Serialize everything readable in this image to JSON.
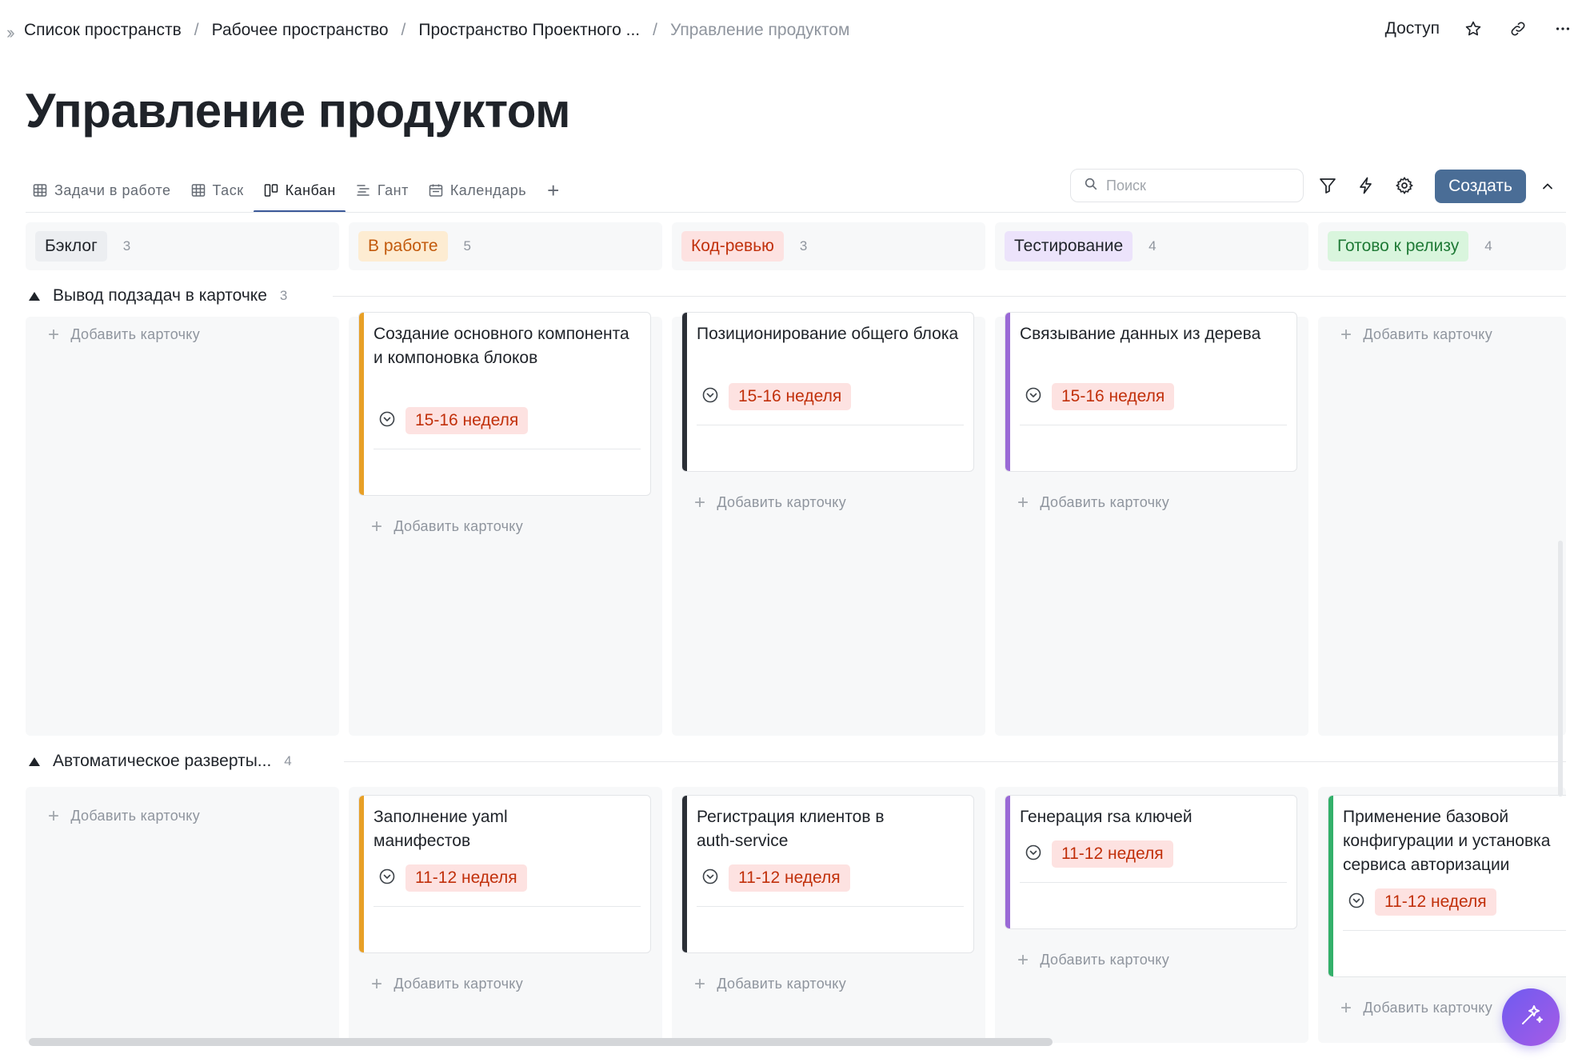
{
  "breadcrumb": {
    "items": [
      "Список пространств",
      "Рабочее пространство",
      "Пространство Проектного ...",
      "Управление продуктом"
    ],
    "separator": "/"
  },
  "header": {
    "access_label": "Доступ"
  },
  "page_title": "Управление продуктом",
  "views": {
    "tabs": [
      {
        "label": "Задачи в работе",
        "icon": "table-icon"
      },
      {
        "label": "Таск",
        "icon": "table-icon"
      },
      {
        "label": "Канбан",
        "icon": "kanban-icon",
        "active": true
      },
      {
        "label": "Гант",
        "icon": "gantt-icon"
      },
      {
        "label": "Календарь",
        "icon": "calendar-icon"
      }
    ],
    "add_label": "+"
  },
  "toolbar": {
    "search_placeholder": "Поиск",
    "create_label": "Создать"
  },
  "columns": [
    {
      "label": "Бэклог",
      "count": "3",
      "bg": "#eceef1",
      "color": "#1f2329"
    },
    {
      "label": "В работе",
      "count": "5",
      "bg": "#fdecd2",
      "color": "#c25a0c"
    },
    {
      "label": "Код-ревью",
      "count": "3",
      "bg": "#fde2e1",
      "color": "#c1300b"
    },
    {
      "label": "Тестирование",
      "count": "4",
      "bg": "#ece3fb",
      "color": "#1f2329"
    },
    {
      "label": "Готово к релизу",
      "count": "4",
      "bg": "#d9f5dd",
      "color": "#1f7a36"
    }
  ],
  "add_card_label": "Добавить карточку",
  "groups": [
    {
      "title": "Вывод подзадач в карточке",
      "count": "3",
      "cards": [
        {
          "title": "Создание основного компонента и компоновка блоков",
          "tag": "15-16 неделя",
          "accent": "#e8a027"
        },
        {
          "title": "Позиционирование общего блока",
          "tag": "15-16 неделя",
          "accent": "#2b2f36"
        },
        {
          "title": "Связывание данных из дерева",
          "tag": "15-16 неделя",
          "accent": "#9a6ad6"
        }
      ]
    },
    {
      "title": "Автоматическое разверты...",
      "count": "4",
      "cards": [
        {
          "title": "Заполнение yaml манифестов",
          "tag": "11-12 неделя",
          "accent": "#e8a027"
        },
        {
          "title": "Регистрация клиентов в auth-service",
          "tag": "11-12 неделя",
          "accent": "#2b2f36"
        },
        {
          "title": "Генерация rsa ключей",
          "tag": "11-12 неделя",
          "accent": "#9a6ad6"
        },
        {
          "title": "Применение базовой конфигурации и установка сервиса авторизации",
          "tag": "11-12 неделя",
          "accent": "#33b06a"
        }
      ]
    }
  ]
}
